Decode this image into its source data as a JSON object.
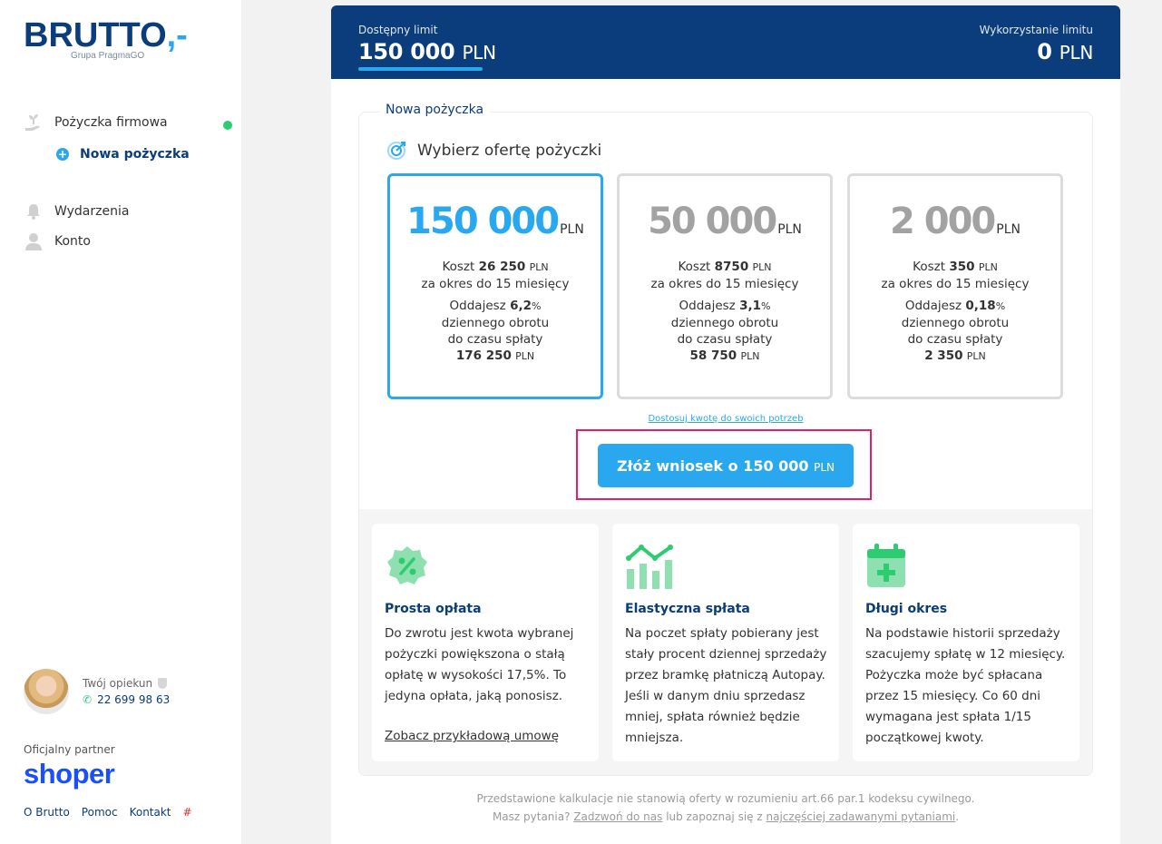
{
  "sidebar": {
    "logo": {
      "text": "BRUTTO",
      "suffix": ",-",
      "sub": "Grupa PragmaGO"
    },
    "nav": {
      "loan": "Pożyczka firmowa",
      "new_loan": "Nowa pożyczka",
      "events": "Wydarzenia",
      "account": "Konto"
    },
    "advisor": {
      "label": "Twój opiekun",
      "phone": "22 699 98 63"
    },
    "partner": {
      "label": "Oficjalny partner",
      "name": "shoper"
    },
    "links": {
      "about": "O Brutto",
      "help": "Pomoc",
      "contact": "Kontakt",
      "hash": "#"
    }
  },
  "limit": {
    "available_label": "Dostępny limit",
    "available_value": "150 000",
    "available_unit": "PLN",
    "usage_label": "Wykorzystanie limitu",
    "usage_value": "0",
    "usage_unit": "PLN"
  },
  "panel": {
    "legend": "Nowa pożyczka",
    "choose_title": "Wybierz ofertę pożyczki",
    "offers": [
      {
        "amount": "150 000",
        "unit": "PLN",
        "cost_prefix": "Koszt",
        "cost": "26 250",
        "cost_unit": "PLN",
        "period": "za okres do 15 miesięcy",
        "repay_prefix": "Oddajesz",
        "percent": "6,2",
        "percent_unit": "%",
        "line1": "dziennego obrotu",
        "line2": "do czasu spłaty",
        "total": "176 250",
        "total_unit": "PLN",
        "selected": true
      },
      {
        "amount": "50 000",
        "unit": "PLN",
        "cost_prefix": "Koszt",
        "cost": "8750",
        "cost_unit": "PLN",
        "period": "za okres do 15 miesięcy",
        "repay_prefix": "Oddajesz",
        "percent": "3,1",
        "percent_unit": "%",
        "line1": "dziennego obrotu",
        "line2": "do czasu spłaty",
        "total": "58 750",
        "total_unit": "PLN",
        "selected": false
      },
      {
        "amount": "2 000",
        "unit": "PLN",
        "cost_prefix": "Koszt",
        "cost": "350",
        "cost_unit": "PLN",
        "period": "za okres do 15 miesięcy",
        "repay_prefix": "Oddajesz",
        "percent": "0,18",
        "percent_unit": "%",
        "line1": "dziennego obrotu",
        "line2": "do czasu spłaty",
        "total": "2 350",
        "total_unit": "PLN",
        "selected": false
      }
    ],
    "customize_link": "Dostosuj kwotę do swoich potrzeb",
    "apply_button": {
      "label": "Złóż wniosek o 150 000",
      "unit": "PLN"
    }
  },
  "features": [
    {
      "icon": "percent-badge-icon",
      "title": "Prosta opłata",
      "text": "Do zwrotu jest kwota wybranej pożyczki powiększona o stałą opłatę w wysokości 17,5%. To jedyna opłata, jaką ponosisz.",
      "link": "Zobacz przykładową umowę"
    },
    {
      "icon": "chart-trend-icon",
      "title": "Elastyczna spłata",
      "text": "Na poczet spłaty pobierany jest stały procent dziennej sprzedaży przez bramkę płatniczą Autopay. Jeśli w danym dniu sprzedasz mniej, spłata również będzie mniejsza."
    },
    {
      "icon": "calendar-plus-icon",
      "title": "Długi okres",
      "text": "Na podstawie historii sprzedaży szacujemy spłatę w 12 miesięcy. Pożyczka może być spłacana przez 15 miesięcy. Co 60 dni wymagana jest spłata 1/15 początkowej kwoty."
    }
  ],
  "disclaimer": {
    "line1": "Przedstawione kalkulacje nie stanowią oferty w rozumieniu art.66 par.1 kodeksu cywilnego.",
    "prefix": "Masz pytania?",
    "call_link": "Zadzwoń do nas",
    "middle": "lub zapoznaj się z",
    "faq_link": "najczęściej zadawanymi pytaniami",
    "suffix": "."
  },
  "colors": {
    "navy": "#0b3c7b",
    "accent": "#2aa8ef",
    "green": "#2ecc71",
    "highlight": "#e0206e"
  }
}
